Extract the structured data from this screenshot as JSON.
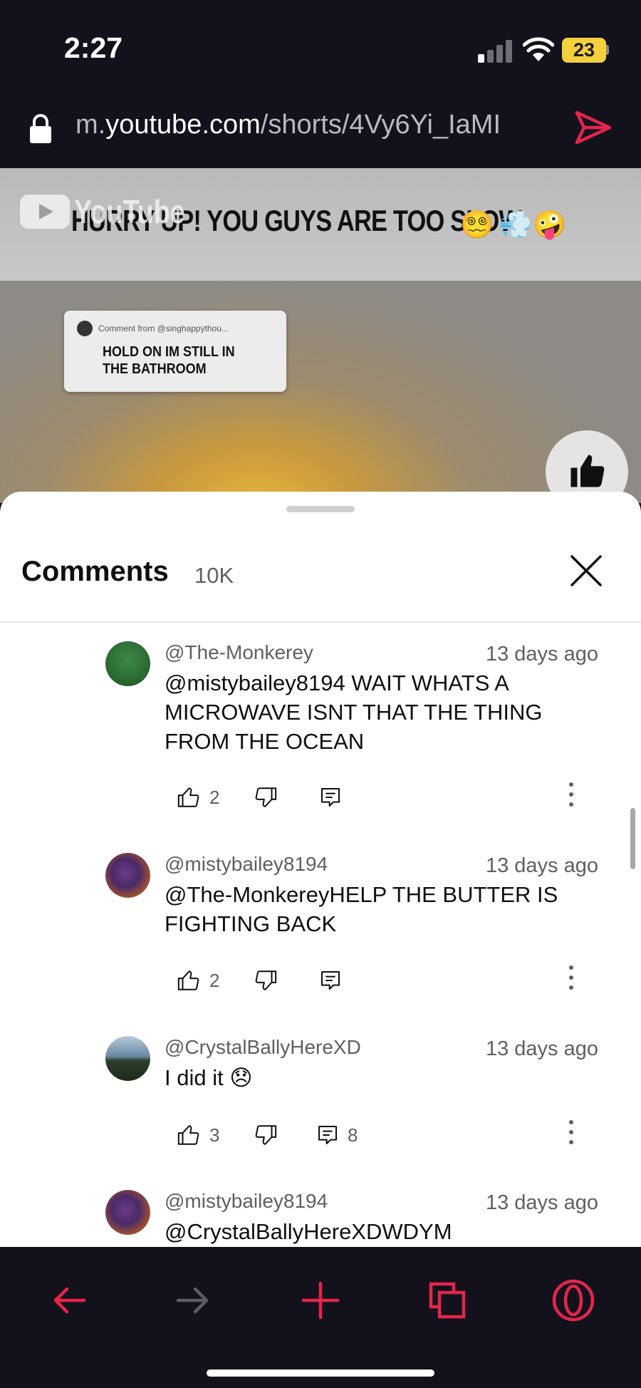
{
  "status_bar": {
    "time": "2:27",
    "battery": "23"
  },
  "browser": {
    "url_prefix": "m.",
    "url_host": "youtube.com",
    "url_path": "/shorts/4Vy6Yi_IaMI",
    "accent_color": "#e5254b"
  },
  "video": {
    "title": "HURRY UP! YOU GUYS ARE TOO SLOW",
    "watermark": "YouTube",
    "sticker_from": "Comment from @singhappythou...",
    "sticker_text": "HOLD ON IM STILL IN THE BATHROOM"
  },
  "comments_sheet": {
    "title": "Comments",
    "count": "10K",
    "items": [
      {
        "author": "@The-Monkerey",
        "time": "13 days ago",
        "text": "@mistybailey8194 WAIT WHATS A MICROWAVE ISNT THAT THE THING FROM THE OCEAN",
        "likes": "2",
        "replies": ""
      },
      {
        "author": "@mistybailey8194",
        "time": "13 days ago",
        "text": "@The-MonkereyHELP THE BUTTER IS FIGHTING BACK",
        "likes": "2",
        "replies": ""
      },
      {
        "author": "@CrystalBallyHereXD",
        "time": "13 days ago",
        "text": "I did it 😞",
        "likes": "3",
        "replies": "8"
      },
      {
        "author": "@mistybailey8194",
        "time": "13 days ago",
        "text": "@CrystalBallyHereXDWDYM",
        "likes": "",
        "replies": ""
      }
    ]
  },
  "icons": {
    "back": "back-arrow-icon",
    "forward": "forward-arrow-icon",
    "new_tab": "plus-icon",
    "tabs": "tabs-icon",
    "opera_menu": "opera-logo-icon"
  }
}
